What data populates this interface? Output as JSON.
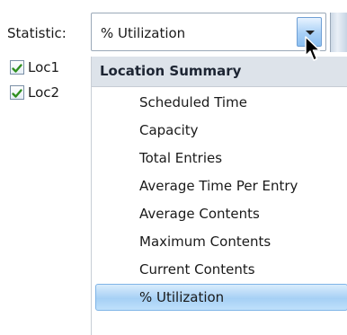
{
  "statistic": {
    "label": "Statistic:",
    "selected_value": "% Utilization"
  },
  "locations": [
    {
      "label": "Loc1",
      "checked": true
    },
    {
      "label": "Loc2",
      "checked": true
    }
  ],
  "dropdown": {
    "group_header": "Location Summary",
    "options": [
      "Scheduled Time",
      "Capacity",
      "Total Entries",
      "Average Time Per Entry",
      "Average Contents",
      "Maximum Contents",
      "Current Contents",
      "% Utilization"
    ],
    "selected_option": "% Utilization"
  },
  "colors": {
    "check_green": "#2f8f1f",
    "selection_blue": "#a6d0f5"
  }
}
